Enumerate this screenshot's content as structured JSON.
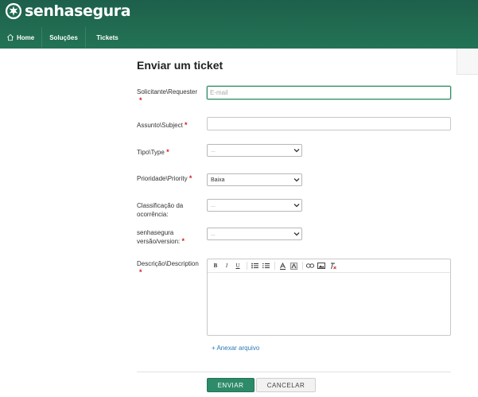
{
  "brand": {
    "name": "senhasegura"
  },
  "nav": {
    "home": "Home",
    "solutions": "Soluções",
    "tickets": "Tickets"
  },
  "form": {
    "title": "Enviar um ticket",
    "required_mark": "*",
    "requester": {
      "label": "Solicitante\\Requester",
      "placeholder": "E-mail"
    },
    "subject": {
      "label": "Assunto\\Subject"
    },
    "type": {
      "label": "Tipo\\Type",
      "value": "..."
    },
    "priority": {
      "label": "Prioridade\\Priority",
      "value": "Baixa"
    },
    "classification": {
      "label": "Classificação da ocorrência:",
      "value": "..."
    },
    "version": {
      "label": "senhasegura versão/version:",
      "value": "..."
    },
    "description": {
      "label": "Descrição\\Description"
    },
    "attach": "+ Anexar arquivo",
    "send": "ENVIAR",
    "cancel": "CANCELAR"
  },
  "colors": {
    "header": "#20684f",
    "accent": "#2e8b6a",
    "required": "#d21f1f",
    "link": "#2a7ab8"
  }
}
